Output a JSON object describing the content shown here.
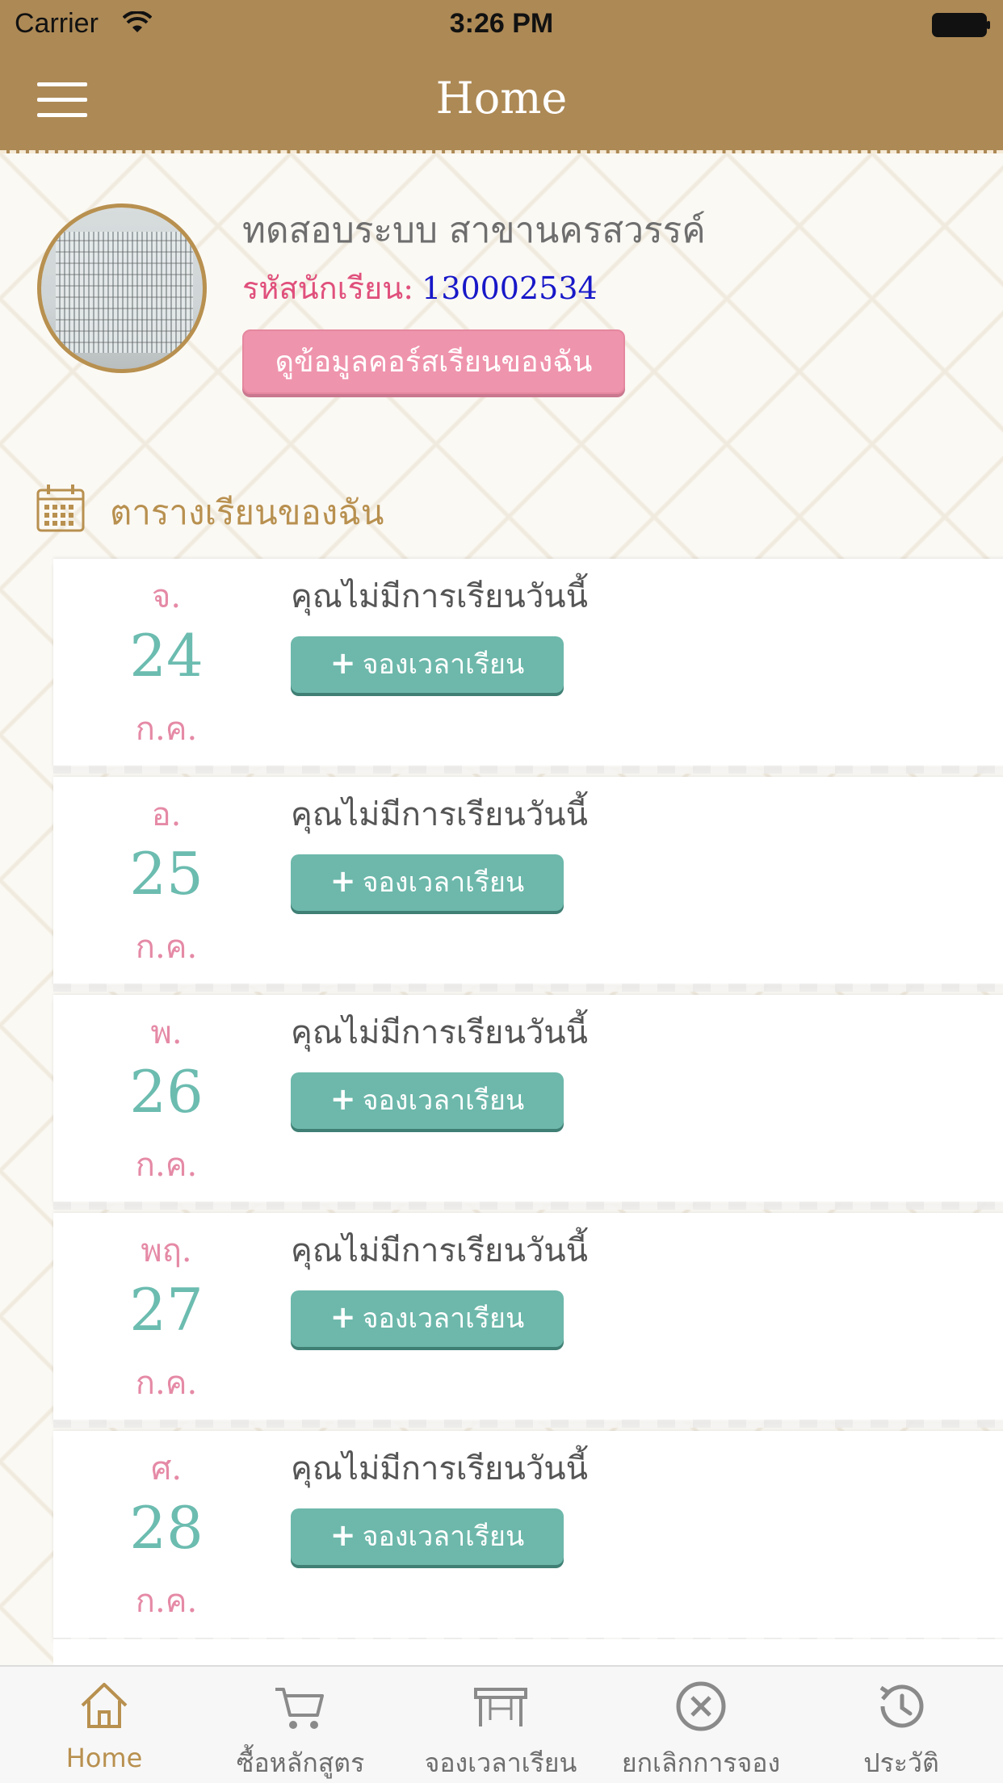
{
  "status_bar": {
    "carrier": "Carrier",
    "time": "3:26 PM"
  },
  "nav": {
    "title": "Home"
  },
  "profile": {
    "name": "ทดสอบระบบ สาขานครสวรรค์",
    "student_id_label": "รหัสนักเรียน:",
    "student_id": "130002534",
    "course_button": "ดูข้อมูลคอร์สเรียนของฉัน"
  },
  "schedule": {
    "title": "ตารางเรียนของฉัน",
    "days": [
      {
        "weekday": "จ.",
        "day": "24",
        "month": "ก.ค.",
        "message": "คุณไม่มีการเรียนวันนี้",
        "button": "จองเวลาเรียน"
      },
      {
        "weekday": "อ.",
        "day": "25",
        "month": "ก.ค.",
        "message": "คุณไม่มีการเรียนวันนี้",
        "button": "จองเวลาเรียน"
      },
      {
        "weekday": "พ.",
        "day": "26",
        "month": "ก.ค.",
        "message": "คุณไม่มีการเรียนวันนี้",
        "button": "จองเวลาเรียน"
      },
      {
        "weekday": "พฤ.",
        "day": "27",
        "month": "ก.ค.",
        "message": "คุณไม่มีการเรียนวันนี้",
        "button": "จองเวลาเรียน"
      },
      {
        "weekday": "ศ.",
        "day": "28",
        "month": "ก.ค.",
        "message": "คุณไม่มีการเรียนวันนี้",
        "button": "จองเวลาเรียน"
      }
    ]
  },
  "tabs": [
    {
      "label": "Home",
      "icon": "home-icon",
      "active": true
    },
    {
      "label": "ซื้อหลักสูตร",
      "icon": "cart-icon",
      "active": false
    },
    {
      "label": "จองเวลาเรียน",
      "icon": "desk-icon",
      "active": false
    },
    {
      "label": "ยกเลิกการจอง",
      "icon": "cancel-icon",
      "active": false
    },
    {
      "label": "ประวัติ",
      "icon": "history-icon",
      "active": false
    }
  ],
  "colors": {
    "brand": "#ad8955",
    "accent_pink": "#ef94ad",
    "accent_teal": "#6db8ab",
    "id_blue": "#1818c8"
  }
}
